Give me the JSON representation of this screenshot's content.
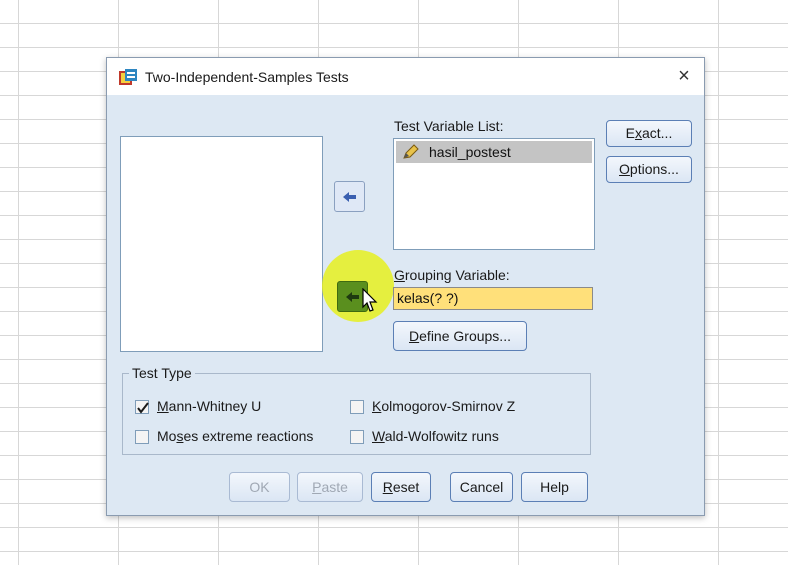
{
  "dialog": {
    "title": "Two-Independent-Samples Tests",
    "close_glyph": "×"
  },
  "test_variable_list": {
    "label": "Test Variable List:",
    "items": [
      "hasil_postest"
    ]
  },
  "grouping_variable": {
    "label_prefix": "G",
    "label_rest": "rouping Variable:",
    "value": "kelas(? ?)"
  },
  "buttons": {
    "exact_pre": "E",
    "exact_u": "x",
    "exact_post": "act...",
    "options_u": "O",
    "options_post": "ptions...",
    "define_u": "D",
    "define_post": "efine Groups...",
    "ok": "OK",
    "paste_u": "P",
    "paste_post": "aste",
    "reset_u": "R",
    "reset_post": "eset",
    "cancel": "Cancel",
    "help": "Help"
  },
  "test_type": {
    "title": "Test Type",
    "options": [
      {
        "pre": "",
        "u": "M",
        "post": "ann-Whitney U",
        "checked": true
      },
      {
        "pre": "",
        "u": "K",
        "post": "olmogorov-Smirnov Z",
        "checked": false
      },
      {
        "pre": "Mo",
        "u": "s",
        "post": "es extreme reactions",
        "checked": false
      },
      {
        "pre": "",
        "u": "W",
        "post": "ald-Wolfowitz runs",
        "checked": false
      }
    ]
  },
  "icons": {
    "app": "spss-dialog-icon",
    "variable": "scale-variable-pencil-icon",
    "move_arrow": "move-arrow-icon",
    "cursor": "mouse-pointer-icon"
  },
  "colors": {
    "dialog_bg": "#dde8f3",
    "grouping_field_bg": "#ffe07a",
    "highlight": "#e6f01e",
    "active_arrow_button": "#5a8f1e",
    "selected_item": "#c4c4c4"
  }
}
